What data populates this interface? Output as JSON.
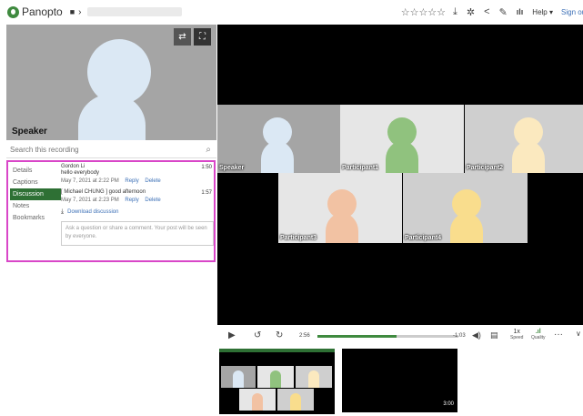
{
  "header": {
    "logo_text": "Panopto",
    "crumb_sep": "›",
    "stars": "☆☆☆☆☆",
    "help_label": "Help ▾",
    "signin_label": "Sign out"
  },
  "speaker_panel": {
    "label": "Speaker"
  },
  "search": {
    "placeholder": "Search this recording"
  },
  "tabs": [
    {
      "label": "Details"
    },
    {
      "label": "Captions"
    },
    {
      "label": "Discussion",
      "active": true
    },
    {
      "label": "Notes"
    },
    {
      "label": "Bookmarks"
    }
  ],
  "discussion": {
    "messages": [
      {
        "author": "Gordon Li",
        "body": "hello everybody",
        "date": "May 7, 2021 at 2:22 PM",
        "reply": "Reply",
        "delete": "Delete",
        "time": "1:50"
      },
      {
        "author": "",
        "body": "[ Michael CHUNG ] good afternoon",
        "date": "May 7, 2021 at 2:23 PM",
        "reply": "Reply",
        "delete": "Delete",
        "time": "1:57"
      }
    ],
    "download_label": "Download discussion",
    "comment_placeholder": "Ask a question or share a comment. Your post will be seen by everyone."
  },
  "video": {
    "participants": [
      {
        "label": "Speaker",
        "color": "#dbe8f4"
      },
      {
        "label": "Participant1",
        "color": "#90c27e"
      },
      {
        "label": "Participant2",
        "color": "#fbe9bf"
      },
      {
        "label": "Participant3",
        "color": "#f2c2a3"
      },
      {
        "label": "Participant4",
        "color": "#f9dd8d"
      }
    ]
  },
  "controls": {
    "current_time": "2:56",
    "remaining_time": "-1:03",
    "progress": 0.56,
    "speed_value": "1x",
    "speed_label": "Speed",
    "quality_label": "Quality",
    "more": "···"
  },
  "thumbnails": [
    {
      "time": ""
    },
    {
      "time": "3:00"
    }
  ],
  "colors": {
    "accent": "#2e7034",
    "highlight": "#d946c8",
    "link": "#3b6fb6"
  }
}
